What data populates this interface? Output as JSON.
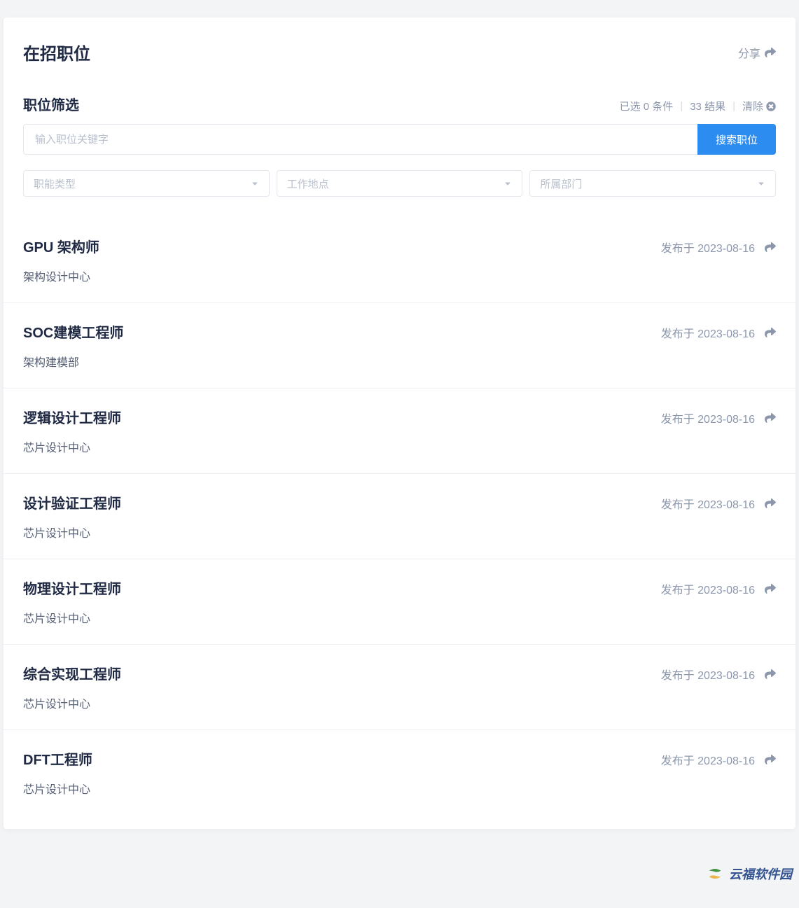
{
  "header": {
    "title": "在招职位",
    "share_label": "分享"
  },
  "filter": {
    "title": "职位筛选",
    "selected_text": "已选 0 条件",
    "result_text": "33 结果",
    "clear_label": "清除"
  },
  "search": {
    "placeholder": "输入职位关键字",
    "button_label": "搜索职位"
  },
  "selects": {
    "function_type": "职能类型",
    "location": "工作地点",
    "department": "所属部门"
  },
  "jobs": [
    {
      "title": "GPU 架构师",
      "date": "发布于 2023-08-16",
      "dept": "架构设计中心"
    },
    {
      "title": "SOC建模工程师",
      "date": "发布于 2023-08-16",
      "dept": "架构建模部"
    },
    {
      "title": "逻辑设计工程师",
      "date": "发布于 2023-08-16",
      "dept": "芯片设计中心"
    },
    {
      "title": "设计验证工程师",
      "date": "发布于 2023-08-16",
      "dept": "芯片设计中心"
    },
    {
      "title": "物理设计工程师",
      "date": "发布于 2023-08-16",
      "dept": "芯片设计中心"
    },
    {
      "title": "综合实现工程师",
      "date": "发布于 2023-08-16",
      "dept": "芯片设计中心"
    },
    {
      "title": "DFT工程师",
      "date": "发布于 2023-08-16",
      "dept": "芯片设计中心"
    }
  ],
  "watermark": "云福软件园"
}
